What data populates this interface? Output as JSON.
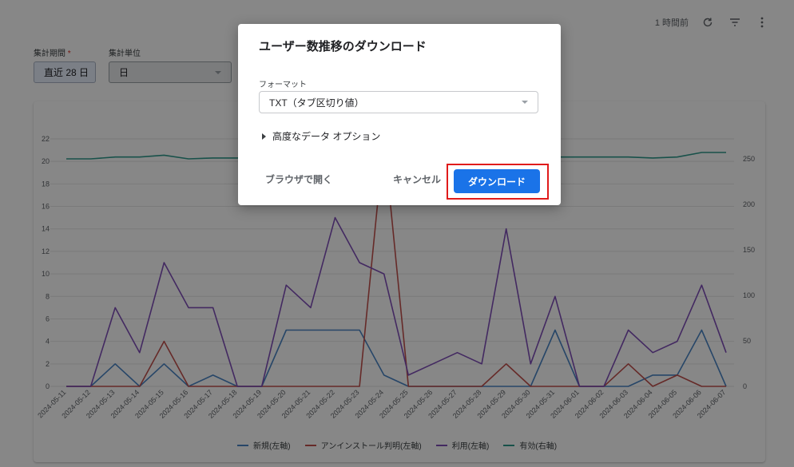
{
  "toolbar": {
    "updated": "1 時間前",
    "refresh_icon": "refresh-icon",
    "filter_icon": "filter-icon",
    "more_icon": "more-vert-icon"
  },
  "filters": {
    "period_label": "集計期間",
    "period_required": "*",
    "period_value": "直近 28 日",
    "unit_label": "集計単位",
    "unit_value": "日"
  },
  "dialog": {
    "title": "ユーザー数推移のダウンロード",
    "format_label": "フォーマット",
    "format_value": "TXT（タブ区切り値）",
    "advanced_label": "高度なデータ オプション",
    "open_browser": "ブラウザで開く",
    "cancel": "キャンセル",
    "download": "ダウンロード"
  },
  "colors": {
    "new": "#4a84c4",
    "uninstall": "#c0504d",
    "usage": "#7f4fb8",
    "active": "#2f9a8c",
    "primary": "#1a73e8",
    "highlight": "#e01b1b"
  },
  "chart_data": {
    "type": "line",
    "x": [
      "2024-05-11",
      "2024-05-12",
      "2024-05-13",
      "2024-05-14",
      "2024-05-15",
      "2024-05-16",
      "2024-05-17",
      "2024-05-18",
      "2024-05-19",
      "2024-05-20",
      "2024-05-21",
      "2024-05-22",
      "2024-05-23",
      "2024-05-24",
      "2024-05-25",
      "2024-05-26",
      "2024-05-27",
      "2024-05-28",
      "2024-05-29",
      "2024-05-30",
      "2024-05-31",
      "2024-06-01",
      "2024-06-02",
      "2024-06-03",
      "2024-06-04",
      "2024-06-05",
      "2024-06-06",
      "2024-06-07"
    ],
    "y_left_ticks": [
      "0",
      "2",
      "4",
      "6",
      "8",
      "10",
      "12",
      "14",
      "16",
      "18",
      "20",
      "22"
    ],
    "y_right_ticks": [
      "0",
      "50",
      "100",
      "150",
      "200",
      "250"
    ],
    "ylim_left": [
      0,
      22.5
    ],
    "ylim_right": [
      0,
      281
    ],
    "grid": true,
    "legend_position": "bottom",
    "series": [
      {
        "name": "新規(左軸)",
        "axis": "left",
        "color": "#4a84c4",
        "values": [
          0,
          0,
          2,
          0,
          2,
          0,
          1,
          0,
          0,
          5,
          5,
          5,
          5,
          1,
          0,
          0,
          0,
          0,
          0,
          0,
          5,
          0,
          0,
          0,
          1,
          1,
          5,
          0
        ]
      },
      {
        "name": "アンインストール判明(左軸)",
        "axis": "left",
        "color": "#c0504d",
        "values": [
          0,
          0,
          0,
          0,
          4,
          0,
          0,
          0,
          0,
          0,
          0,
          0,
          0,
          22,
          0,
          0,
          0,
          0,
          2,
          0,
          0,
          0,
          0,
          2,
          0,
          1,
          0,
          0
        ]
      },
      {
        "name": "利用(左軸)",
        "axis": "left",
        "color": "#7f4fb8",
        "values": [
          0,
          0,
          7,
          3,
          11,
          7,
          7,
          0,
          0,
          9,
          7,
          15,
          11,
          10,
          1,
          2,
          3,
          2,
          14,
          2,
          8,
          0,
          0,
          5,
          3,
          4,
          9,
          3
        ]
      },
      {
        "name": "有効(右軸)",
        "axis": "right",
        "color": "#2f9a8c",
        "values": [
          250,
          250,
          252,
          252,
          254,
          250,
          251,
          251,
          252,
          252,
          252,
          252,
          252,
          252,
          252,
          252,
          252,
          252,
          252,
          252,
          252,
          252,
          252,
          252,
          251,
          252,
          257,
          257
        ]
      }
    ]
  }
}
